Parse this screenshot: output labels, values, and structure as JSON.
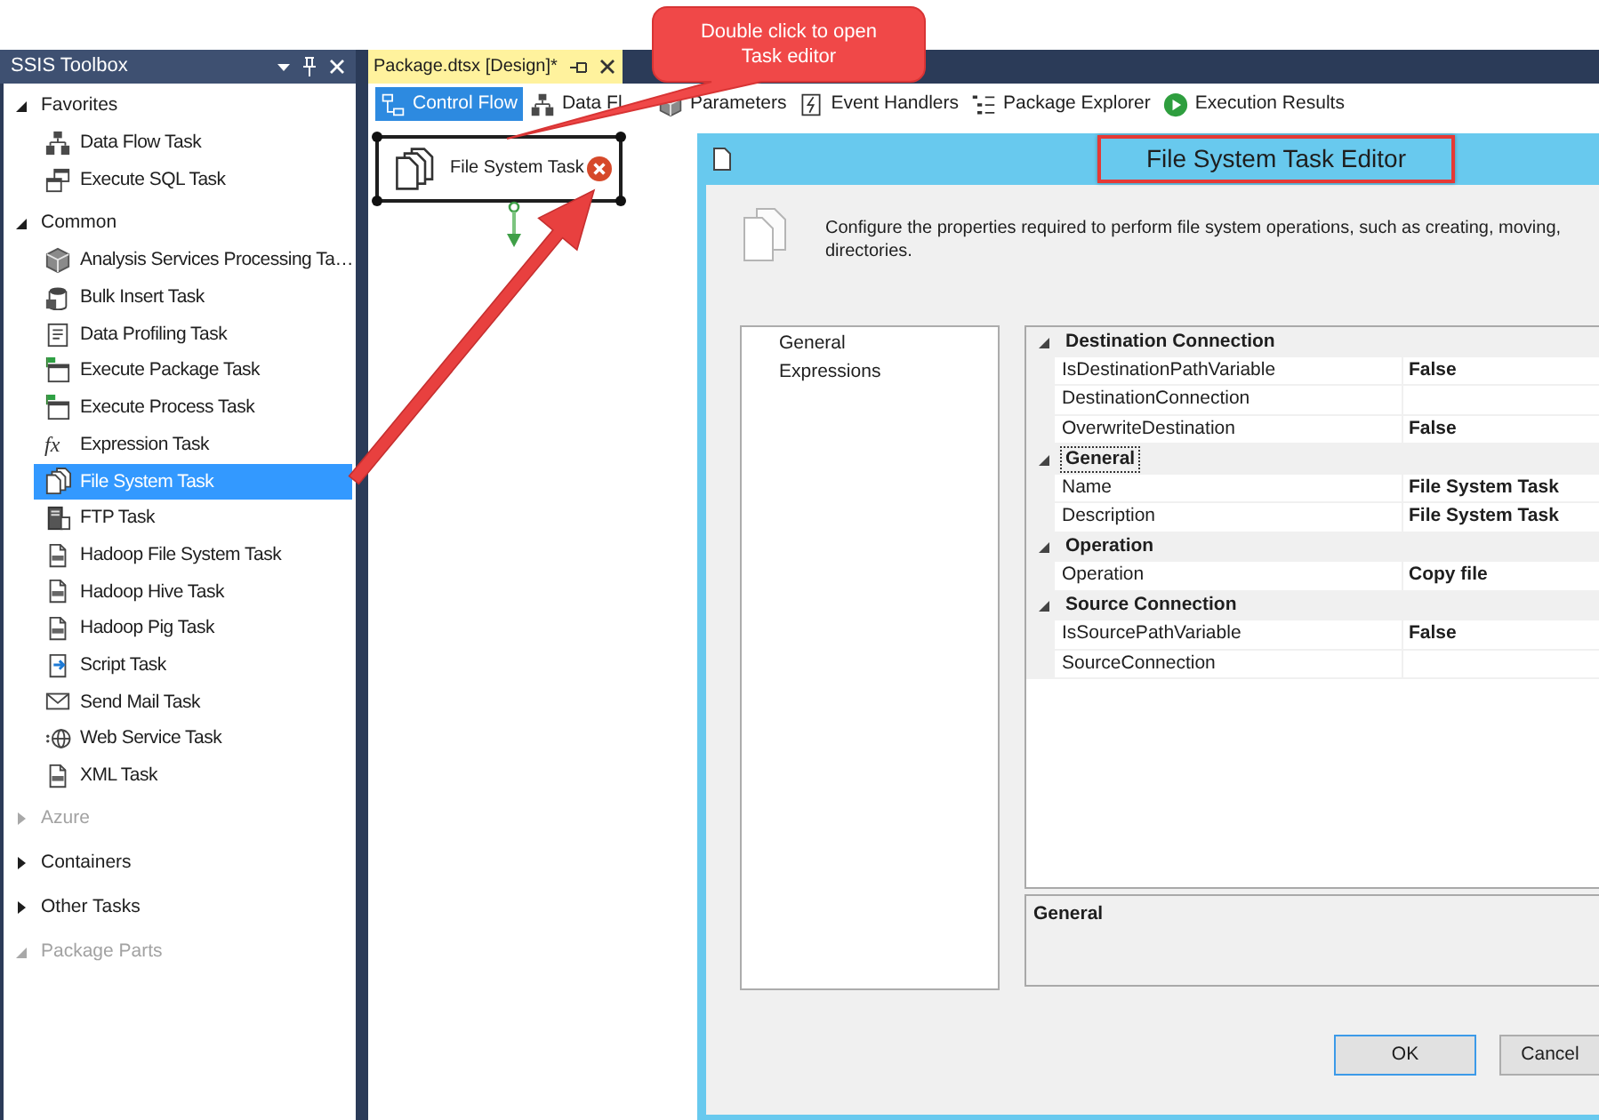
{
  "toolbox": {
    "title": "SSIS Toolbox",
    "groups": [
      {
        "label": "Favorites",
        "expanded": true,
        "disabled": false,
        "items": [
          {
            "label": "Data Flow Task",
            "selected": false
          },
          {
            "label": "Execute SQL Task",
            "selected": false
          }
        ]
      },
      {
        "label": "Common",
        "expanded": true,
        "disabled": false,
        "items": [
          {
            "label": "Analysis Services Processing Ta…",
            "selected": false
          },
          {
            "label": "Bulk Insert Task",
            "selected": false
          },
          {
            "label": "Data Profiling Task",
            "selected": false
          },
          {
            "label": "Execute Package Task",
            "selected": false
          },
          {
            "label": "Execute Process Task",
            "selected": false
          },
          {
            "label": "Expression Task",
            "selected": false,
            "icon_text": "fx"
          },
          {
            "label": "File System Task",
            "selected": true
          },
          {
            "label": "FTP Task",
            "selected": false
          },
          {
            "label": "Hadoop File System Task",
            "selected": false
          },
          {
            "label": "Hadoop Hive Task",
            "selected": false
          },
          {
            "label": "Hadoop Pig Task",
            "selected": false
          },
          {
            "label": "Script Task",
            "selected": false
          },
          {
            "label": "Send Mail Task",
            "selected": false
          },
          {
            "label": "Web Service Task",
            "selected": false
          },
          {
            "label": "XML Task",
            "selected": false
          }
        ]
      },
      {
        "label": "Azure",
        "expanded": false,
        "disabled": true
      },
      {
        "label": "Containers",
        "expanded": false,
        "disabled": false
      },
      {
        "label": "Other Tasks",
        "expanded": false,
        "disabled": false
      },
      {
        "label": "Package Parts",
        "expanded": true,
        "disabled": true
      }
    ]
  },
  "document_tab": {
    "title": "Package.dtsx [Design]*"
  },
  "designer_tabs": [
    {
      "label": "Control Flow",
      "selected": true
    },
    {
      "label": "Data Fl",
      "selected": false
    },
    {
      "label": "Parameters",
      "selected": false
    },
    {
      "label": "Event Handlers",
      "selected": false
    },
    {
      "label": "Package Explorer",
      "selected": false
    },
    {
      "label": "Execution Results",
      "selected": false
    }
  ],
  "canvas": {
    "task": {
      "label": "File System Task",
      "error": true
    }
  },
  "callout": {
    "lines": [
      "Double click to open",
      "Task editor"
    ]
  },
  "editor": {
    "title": "File System Task Editor",
    "title_outlined": true,
    "description_lines": [
      "Configure the properties required to perform file system operations, such as creating, moving,",
      "directories."
    ],
    "pages": [
      {
        "label": "General"
      },
      {
        "label": "Expressions"
      }
    ],
    "properties": [
      {
        "label": "Destination Connection",
        "expanded": true,
        "focused": false,
        "rows": [
          {
            "name": "IsDestinationPathVariable",
            "value": "False"
          },
          {
            "name": "DestinationConnection"
          },
          {
            "name": "OverwriteDestination",
            "value": "False"
          }
        ]
      },
      {
        "label": "General",
        "expanded": true,
        "focused": true,
        "rows": [
          {
            "name": "Name",
            "value": "File System Task"
          },
          {
            "name": "Description",
            "value": "File System Task"
          }
        ]
      },
      {
        "label": "Operation",
        "expanded": true,
        "focused": false,
        "rows": [
          {
            "name": "Operation",
            "value": "Copy file"
          }
        ]
      },
      {
        "label": "Source Connection",
        "expanded": true,
        "focused": false,
        "rows": [
          {
            "name": "IsSourcePathVariable",
            "value": "False"
          },
          {
            "name": "SourceConnection"
          }
        ]
      }
    ],
    "help_pane": {
      "title": "General"
    },
    "buttons": [
      {
        "label": "OK",
        "default": true
      },
      {
        "label": "Cancel",
        "default": false
      }
    ]
  }
}
